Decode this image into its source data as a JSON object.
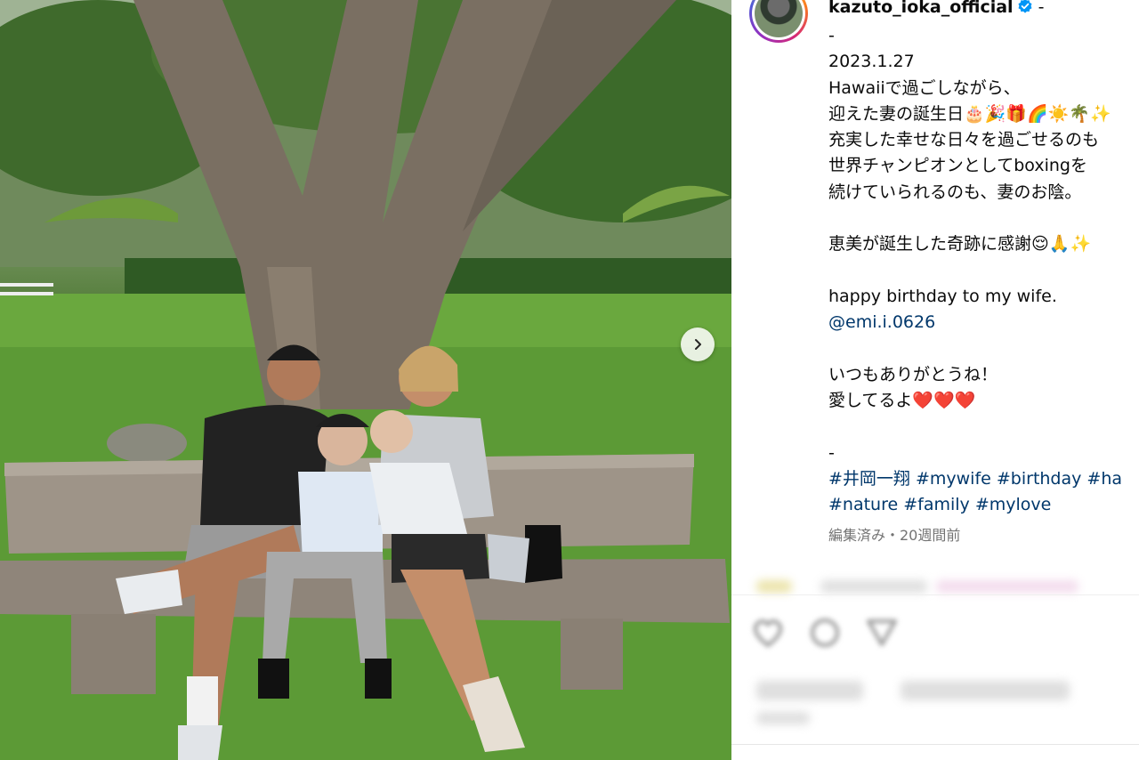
{
  "post": {
    "username": "kazuto_ioka_official",
    "header_suffix": "-",
    "caption_lines": [
      "-",
      "2023.1.27",
      "Hawaiiで過ごしながら、",
      "迎えた妻の誕生日🎂🎉🎁🌈☀️🌴✨",
      "充実した幸せな日々を過ごせるのも",
      "世界チャンピオンとしてboxingを",
      "続けていられるのも、妻のお陰。",
      "",
      "恵美が誕生した奇跡に感謝😌🙏✨",
      "",
      "happy birthday to my wife."
    ],
    "mention": "@emi.i.0626",
    "caption_lines_2": [
      "",
      "いつもありがとうね！",
      "愛してるよ❤️❤️❤️",
      "",
      "-"
    ],
    "hashtags_line1": "#井岡一翔 #mywife #birthday #ha",
    "hashtags_line2": "#nature #family #mylove",
    "meta": "編集済み・20週間前"
  },
  "icons": {
    "verified": "verified-badge-icon",
    "next": "chevron-right-icon",
    "like": "heart-icon",
    "comment": "comment-icon",
    "share": "send-icon"
  },
  "colors": {
    "link": "#00376b",
    "verified": "#0095f6",
    "meta": "#737373"
  }
}
